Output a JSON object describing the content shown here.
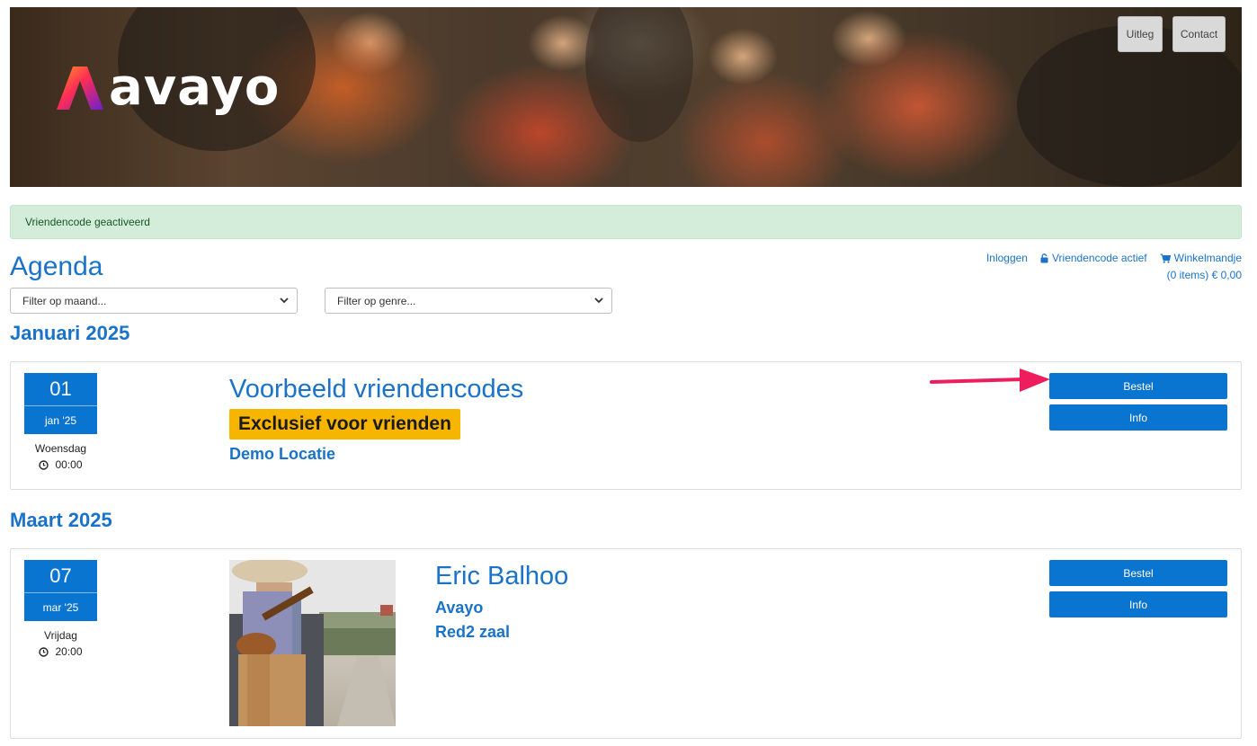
{
  "header": {
    "brand": "avayo",
    "nav": [
      {
        "label": "Uitleg"
      },
      {
        "label": "Contact"
      }
    ]
  },
  "alert": {
    "text": "Vriendencode geactiveerd"
  },
  "page": {
    "title": "Agenda"
  },
  "top_links": {
    "login": "Inloggen",
    "friend_code": "Vriendencode actief",
    "cart": "Winkelmandje",
    "cart_summary": "(0 items) € 0,00"
  },
  "filters": {
    "month": "Filter op maand...",
    "genre": "Filter op genre..."
  },
  "months": [
    {
      "heading": "Januari 2025",
      "events": [
        {
          "day": "01",
          "month_short": "jan '25",
          "weekday": "Woensdag",
          "time": "00:00",
          "title": "Voorbeeld vriendencodes",
          "badge": "Exclusief voor vrienden",
          "location": "Demo Locatie",
          "order_label": "Bestel",
          "info_label": "Info"
        }
      ]
    },
    {
      "heading": "Maart 2025",
      "events": [
        {
          "day": "07",
          "month_short": "mar '25",
          "weekday": "Vrijdag",
          "time": "20:00",
          "title": "Eric Balhoo",
          "organizer": "Avayo",
          "hall": "Red2 zaal",
          "order_label": "Bestel",
          "info_label": "Info"
        }
      ]
    }
  ],
  "colors": {
    "primary": "#0a74d1",
    "link": "#1a73c8",
    "badge": "#f7b500",
    "alert_bg": "#d4edda",
    "alert_text": "#155724",
    "arrow": "#ee1d5c"
  }
}
